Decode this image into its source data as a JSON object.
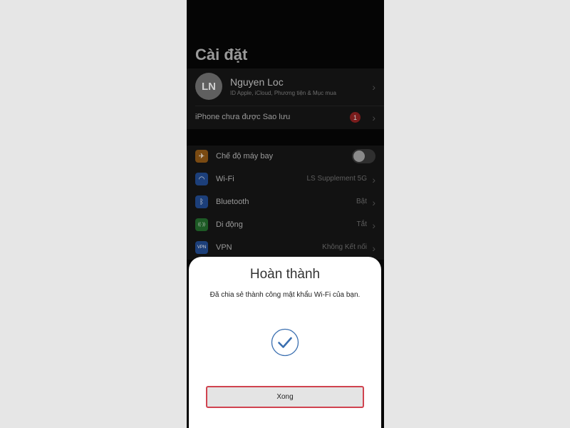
{
  "page_title": "Cài đặt",
  "profile": {
    "initials": "LN",
    "name": "Nguyen Loc",
    "subtitle": "ID Apple, iCloud, Phương tiện & Mục mua"
  },
  "backup": {
    "label": "iPhone chưa được Sao lưu",
    "badge": "1"
  },
  "settings": [
    {
      "icon": "airplane-icon",
      "icon_char": "✈",
      "color": "#7a4a12",
      "label": "Chế độ máy bay",
      "value": "",
      "toggle": "off"
    },
    {
      "icon": "wifi-icon",
      "icon_char": "◠",
      "color": "#1c3f7a",
      "label": "Wi-Fi",
      "value": "LS Supplement 5G"
    },
    {
      "icon": "bluetooth-icon",
      "icon_char": "ᛒ",
      "color": "#1c3f7a",
      "label": "Bluetooth",
      "value": "Bật"
    },
    {
      "icon": "cellular-icon",
      "icon_char": "((·))",
      "color": "#1d5a25",
      "label": "Di động",
      "value": "Tắt"
    },
    {
      "icon": "vpn-icon",
      "icon_char": "VPN",
      "color": "#1c3f7a",
      "label": "VPN",
      "value": "Không Kết nối"
    }
  ],
  "dialog": {
    "title": "Hoàn thành",
    "message": "Đã chia sẻ thành công mật khẩu Wi-Fi của bạn.",
    "button_label": "Xong"
  },
  "colors": {
    "check_stroke": "#3a6fb0",
    "button_border": "#d0434f"
  }
}
